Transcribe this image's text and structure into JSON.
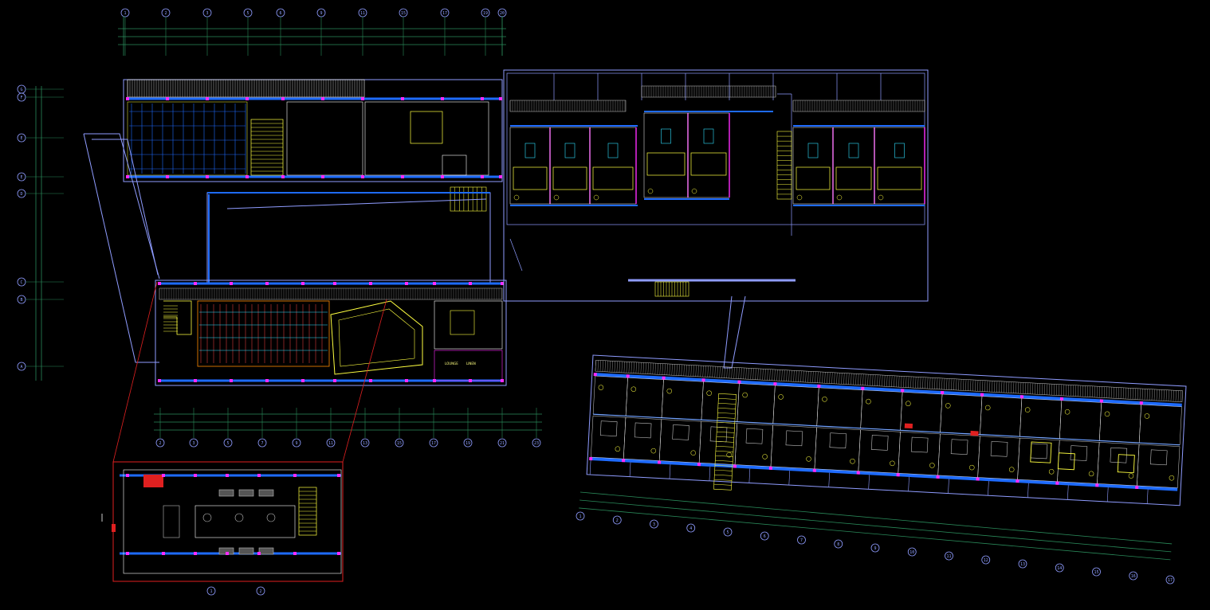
{
  "colors": {
    "background": "#000000",
    "wall": "#ffffff",
    "accent_blue": "#1e6bff",
    "magenta": "#ff2bff",
    "yellow": "#ffff40",
    "cyan": "#30e0ff",
    "dim_green": "#2a8a5a",
    "outline": "#8f9cff",
    "red": "#e02020",
    "orange": "#ff8a00"
  },
  "top_grid_labels": [
    "1",
    "2",
    "3",
    "5",
    "6",
    "9",
    "11",
    "15",
    "17",
    "19",
    "20"
  ],
  "left_grid_labels": [
    "G",
    "F",
    "E",
    "E",
    "D",
    "C",
    "B",
    "A"
  ],
  "bottom_grid_labels": [
    "2",
    "3",
    "5",
    "7",
    "9",
    "11",
    "13",
    "15",
    "17",
    "19",
    "21",
    "23",
    "25"
  ],
  "detail_grid_labels": [
    "1",
    "2"
  ],
  "rotated_grid_labels": [
    "1",
    "2",
    "3",
    "4",
    "5",
    "6",
    "7",
    "8",
    "9",
    "10",
    "11",
    "12",
    "13",
    "14",
    "15",
    "16",
    "17"
  ],
  "room_notes": [
    "LOUNGE",
    "LINEN"
  ]
}
